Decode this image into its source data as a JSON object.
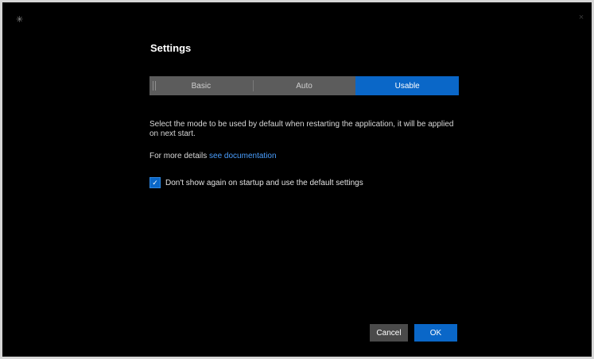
{
  "window": {
    "app_icon": "✳"
  },
  "dialog": {
    "title": "Settings",
    "tabs": [
      {
        "label": "Basic",
        "active": false
      },
      {
        "label": "Auto",
        "active": false
      },
      {
        "label": "Usable",
        "active": true
      }
    ],
    "description": "Select the mode to be used by default when restarting the application, it will be applied on next start.",
    "more_info_prefix": "For more details",
    "more_info_link": "see documentation",
    "checkbox_label": "Don't show again on startup and use the default settings",
    "checkbox_checked": true,
    "cancel_label": "Cancel",
    "ok_label": "OK"
  },
  "colors": {
    "background": "#000000",
    "accent": "#0a67c8",
    "segment_inactive": "#5c5c5c",
    "link": "#4a9fff"
  }
}
